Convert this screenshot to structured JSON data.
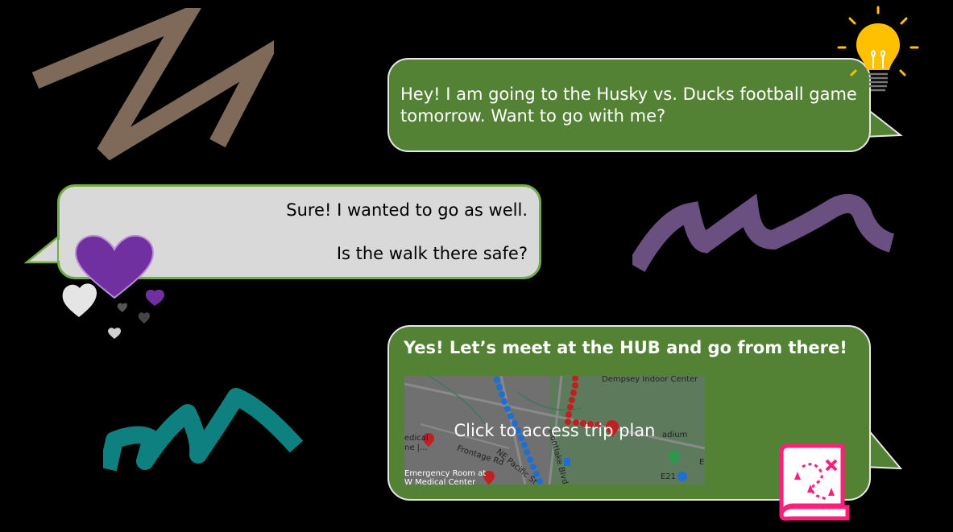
{
  "colors": {
    "background": "#000000",
    "green_bubble": "#548235",
    "grey_bubble": "#d9d9d9",
    "grey_border": "#70ad47",
    "brown_squiggle": "#7f6a5a",
    "purple_squiggle": "#6a5080",
    "teal_squiggle": "#0f8080",
    "lightbulb": "#ffc000",
    "heart_purple": "#7030a0",
    "map_icon": "#ff1f7a"
  },
  "messages": {
    "first": "Hey! I am going to the Husky vs. Ducks football game tomorrow. Want to go with me?",
    "reply_line1": "Sure! I wanted to go as well.",
    "reply_line2": "Is the walk there safe?",
    "third_header": "Yes! Let’s meet at the HUB and go from there!"
  },
  "map": {
    "link_label": "Click to access trip plan",
    "labels": {
      "dempsey": "Dempsey Indoor Center",
      "stadium": "adium",
      "medical": "edical",
      "medical2": "ne |...",
      "frontage": "Frontage Rd",
      "ne_pacific": "NE Pacific St",
      "montlake": "Montlake Blvd",
      "emergency": "Emergency Room at",
      "uw_medical": "W Medical Center",
      "e21": "E21",
      "e": "E"
    }
  },
  "icons": [
    "lightbulb-icon",
    "heart-cluster-icon",
    "map-route-icon"
  ]
}
